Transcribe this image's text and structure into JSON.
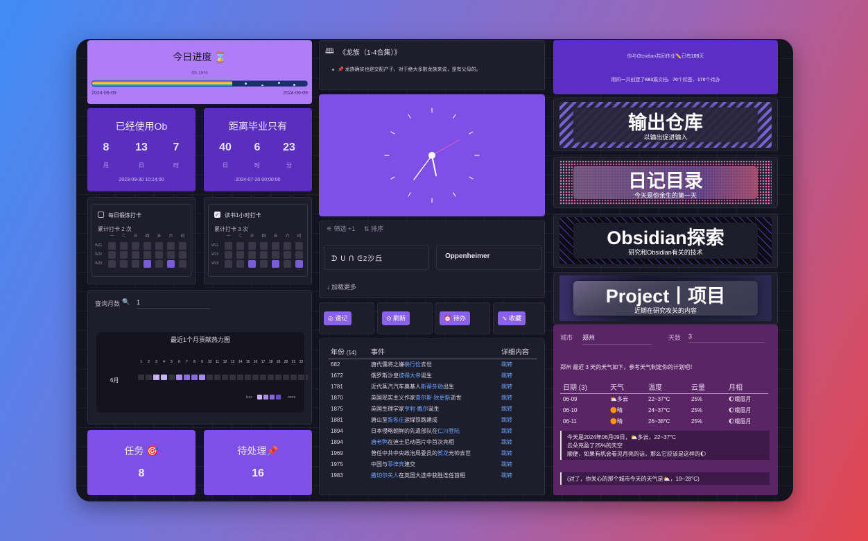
{
  "colors": {
    "accent": "#7f50e6",
    "deep": "#5a2fc0",
    "bg": "#141320",
    "link": "#6aa6ff"
  },
  "progress": {
    "title": "今日进度 ⌛",
    "percent_text": "65.18%",
    "percent": 65.18,
    "start": "2024-06-09",
    "end": "2024-06-09"
  },
  "used": {
    "title": "已经使用Ob",
    "vals": [
      {
        "v": "8",
        "u": "月"
      },
      {
        "v": "13",
        "u": "日"
      },
      {
        "v": "7",
        "u": "时"
      }
    ],
    "date": "2023-09-30 10:14:00"
  },
  "grad": {
    "title": "距离毕业只有",
    "vals": [
      {
        "v": "40",
        "u": "日"
      },
      {
        "v": "6",
        "u": "时"
      },
      {
        "v": "23",
        "u": "分"
      }
    ],
    "date": "2024-07-20 00:00:00"
  },
  "habit1": {
    "title": "每日锻炼打卡",
    "count": "累计打卡 2 次",
    "checked": false
  },
  "habit2": {
    "title": "读书1小时打卡",
    "count": "累计打卡 3 次",
    "checked": true
  },
  "habit_days": [
    "一",
    "二",
    "三",
    "四",
    "五",
    "六",
    "日"
  ],
  "habit_weeks": [
    "W21",
    "W22",
    "W23"
  ],
  "query": {
    "label": "查询月数",
    "icon": "magnifier-icon",
    "value": "1"
  },
  "heat": {
    "title": "最近1个月贡献热力图",
    "month": "6月",
    "days": [
      "1",
      "2",
      "3",
      "4",
      "5",
      "6",
      "7",
      "8",
      "9",
      "10",
      "11",
      "12",
      "13",
      "14",
      "15",
      "16",
      "17",
      "18",
      "19",
      "20",
      "21",
      "22"
    ],
    "less": "less",
    "more": "more"
  },
  "tasks": {
    "label": "任务 🎯",
    "value": "8"
  },
  "pending": {
    "label": "待处理📌",
    "value": "16"
  },
  "book": {
    "title": "《龙族（1-4合集）》",
    "quote": "📌 龙族确实也是交配产子，对于绝大多数龙族来说，是有父母的。"
  },
  "gallery": {
    "filter": "筛选 +1",
    "sort": "排序",
    "items": [
      {
        "label": "ᗪ ᑌ ᑎ ᕮ2沙丘"
      },
      {
        "label": "Oppenheimer"
      }
    ],
    "more": "加载更多"
  },
  "buttons": [
    {
      "label": "速记",
      "icon": "target-icon"
    },
    {
      "label": "刷新",
      "icon": "refresh-icon"
    },
    {
      "label": "待办",
      "icon": "alarm-icon"
    },
    {
      "label": "收藏",
      "icon": "activity-icon"
    }
  ],
  "timeline": {
    "headers": [
      "年份",
      "(14)",
      "事件",
      "详细内容"
    ],
    "link": "跳转",
    "rows": [
      {
        "year": "682",
        "pre": "唐代儒将之嫌",
        "hl": "裴行俭",
        "post": "去世"
      },
      {
        "year": "1672",
        "pre": "俄罗斯沙皇",
        "hl": "彼得大帝",
        "post": "诞生"
      },
      {
        "year": "1781",
        "pre": "近代蒸汽汽车奠基人",
        "hl": "斯蒂芬逊",
        "post": "出生"
      },
      {
        "year": "1870",
        "pre": "英国现实主义作家",
        "hl": "查尔斯·狄更斯",
        "post": "逝世"
      },
      {
        "year": "1875",
        "pre": "英国生理学家",
        "hl": "亨利·戴尔",
        "post": "诞生"
      },
      {
        "year": "1881",
        "pre": "唐山至",
        "hl": "胥各庄",
        "post": "运煤铁路建成"
      },
      {
        "year": "1894",
        "pre": "日本侵略朝鲜的先遣部队在",
        "hl": "仁川登陆",
        "post": ""
      },
      {
        "year": "1894",
        "pre": "",
        "hl": "唐老鸭",
        "post": "在迪士尼动画片中首次亮相"
      },
      {
        "year": "1969",
        "pre": "曾任中共中央政治局委员的",
        "hl": "贺龙",
        "post": "元帅去世"
      },
      {
        "year": "1975",
        "pre": "中国与",
        "hl": "菲律宾",
        "post": "建交"
      },
      {
        "year": "1983",
        "pre": "",
        "hl": "撒切尔夫人",
        "post": "在英国大选中获胜连任首相"
      }
    ]
  },
  "ob_stats": {
    "line1_pre": "你与Obsidian共同作业✏️已有",
    "days": "105",
    "line1_post": "天",
    "line2_a": "期间一共创建了",
    "files": "683",
    "line2_b": "篇文档、",
    "tags": "70",
    "line2_c": "个标签、",
    "todos": "170",
    "line2_d": "个待办"
  },
  "banners": [
    {
      "title": "输出仓库",
      "subtitle": "以输出促进输入"
    },
    {
      "title": "日记目录",
      "subtitle": "今天是你余生的第一天"
    },
    {
      "title": "Obsidian探索",
      "subtitle": "研究和Obsidian有关的技术"
    },
    {
      "title": "Project丨项目",
      "subtitle": "近期在研究攻关的内容"
    }
  ],
  "weather": {
    "city_label": "城市",
    "city": "郑州",
    "days_label": "天数",
    "days": "3",
    "intro": "郑州 最近 3 天的天气如下，参考天气制定你的计划吧！",
    "headers": [
      "日期 (3)",
      "天气",
      "温度",
      "云量",
      "月相"
    ],
    "rows": [
      {
        "date": "06-09",
        "weather": "⛅多云",
        "temp": "22~37°C",
        "cloud": "25%",
        "moon": "🌔蛾眉月"
      },
      {
        "date": "06-10",
        "weather": "🟠晴",
        "temp": "24~37°C",
        "cloud": "25%",
        "moon": "🌔蛾眉月"
      },
      {
        "date": "06-11",
        "weather": "🟠晴",
        "temp": "26~38°C",
        "cloud": "25%",
        "moon": "🌔蛾眉月"
      }
    ],
    "note1": "今天是2024年06月09日，⛅多云，22~37°C",
    "note2": "云朵充盈了25%的天空",
    "note3": "顺便，如果有机会看见月亮的话，那么它应该是这样的🌔",
    "note4": "(对了，你关心的那个城市今天的天气是⛅，19~28°C)"
  }
}
